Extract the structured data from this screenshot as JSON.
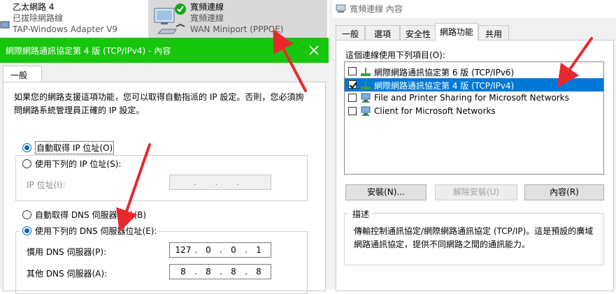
{
  "connections": {
    "ethernet": {
      "title": "乙太網路 4",
      "status": "已拔除網路線",
      "device": "TAP-Windows Adapter V9"
    },
    "broadband": {
      "title": "寬頻連線",
      "status": "寬頻連線",
      "device": "WAN Miniport (PPPOE)"
    }
  },
  "ipv4_dialog": {
    "title": "網際網路通訊協定第 4 版 (TCP/IPv4) - 內容",
    "tab_general": "一般",
    "description": "如果您的網路支援這項功能，您可以取得自動指派的 IP 設定。否則，您必須詢問網路系統管理員正確的 IP 設定。",
    "ip_auto_label": "自動取得 IP 位址(O)",
    "ip_manual_label": "使用下列的 IP 位址(S):",
    "ip_address_label": "IP 位址(I):",
    "ip_address_value": ".       .       .",
    "dns_auto_label": "自動取得 DNS 伺服器位址(B)",
    "dns_manual_label": "使用下列的 DNS 伺服器位址(E):",
    "preferred_dns_label": "慣用 DNS 伺服器(P):",
    "preferred_dns": [
      "127",
      "0",
      "0",
      "1"
    ],
    "alternate_dns_label": "其他 DNS 伺服器(A):",
    "alternate_dns": [
      "8",
      "8",
      "8",
      "8"
    ],
    "selected": {
      "ip": "auto",
      "dns": "manual"
    }
  },
  "properties_dialog": {
    "title": "寬頻連線 內容",
    "tabs": [
      "一般",
      "選項",
      "安全性",
      "網路功能",
      "共用"
    ],
    "active_tab": "網路功能",
    "items_label": "這個連線使用下列項目(O):",
    "items": [
      {
        "label": "網際網路通訊協定第 6 版 (TCP/IPv6)",
        "checked": false,
        "icon": "protocol-icon"
      },
      {
        "label": "網際網路通訊協定第 4 版 (TCP/IPv4)",
        "checked": true,
        "icon": "protocol-icon",
        "selected": true
      },
      {
        "label": "File and Printer Sharing for Microsoft Networks",
        "checked": false,
        "icon": "network-service-icon"
      },
      {
        "label": "Client for Microsoft Networks",
        "checked": false,
        "icon": "network-client-icon"
      }
    ],
    "install_button": "安裝(N)...",
    "uninstall_button": "解除安裝(U)",
    "properties_button": "內容(R)",
    "description_legend": "描述",
    "description_text": "傳輸控制通訊協定/網際網路通訊協定 (TCP/IP)。這是預設的廣域網路通訊協定，提供不同網路之間的通訊能力。"
  },
  "colors": {
    "titlebar_accent": "#16c60c",
    "selection": "#0078d7",
    "radio_accent": "#0067c0",
    "annotation_arrow": "#e8282e"
  }
}
